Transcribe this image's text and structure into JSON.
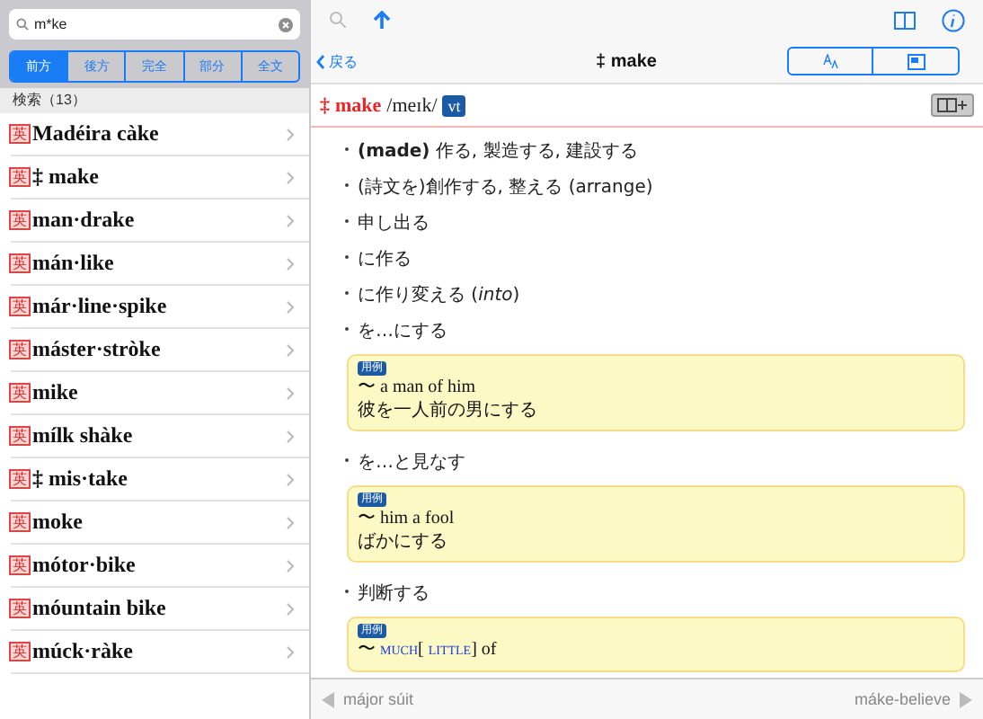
{
  "search": {
    "value": "m*ke"
  },
  "modes": [
    {
      "label": "前方",
      "selected": true
    },
    {
      "label": "後方",
      "selected": false
    },
    {
      "label": "完全",
      "selected": false
    },
    {
      "label": "部分",
      "selected": false
    },
    {
      "label": "全文",
      "selected": false
    }
  ],
  "results": {
    "header": "検索（13）",
    "items": [
      {
        "badge": "英",
        "word": "Madéira càke"
      },
      {
        "badge": "英",
        "word": "‡ make"
      },
      {
        "badge": "英",
        "word": "man·drake"
      },
      {
        "badge": "英",
        "word": "mán·like"
      },
      {
        "badge": "英",
        "word": "már·line·spike"
      },
      {
        "badge": "英",
        "word": "máster·stròke"
      },
      {
        "badge": "英",
        "word": "mike"
      },
      {
        "badge": "英",
        "word": "mílk shàke"
      },
      {
        "badge": "英",
        "word": "‡ mis·take"
      },
      {
        "badge": "英",
        "word": "moke"
      },
      {
        "badge": "英",
        "word": "mótor·bike"
      },
      {
        "badge": "英",
        "word": "móuntain bike"
      },
      {
        "badge": "英",
        "word": "múck·ràke"
      }
    ]
  },
  "nav": {
    "back": "戻る",
    "title": "‡ make"
  },
  "entry": {
    "mark": "‡",
    "headword": "make",
    "pronunciation": "/meɪk/",
    "pos": "vt",
    "senses": [
      {
        "text": "**(made)** 作る, 製造する, 建設する"
      },
      {
        "text": "(詩文を)創作する, 整える (arrange)"
      },
      {
        "text": "申し出る"
      },
      {
        "text": "に作る"
      },
      {
        "text": "に作り変える (*into*)"
      },
      {
        "text": "を…にする",
        "example": {
          "label": "用例",
          "en": [
            {
              "kind": "plain",
              "text": "〜 a man of him"
            }
          ],
          "ja": "彼を一人前の男にする"
        }
      },
      {
        "text": "を…と見なす",
        "example": {
          "label": "用例",
          "en": [
            {
              "kind": "plain",
              "text": "〜 him a fool"
            }
          ],
          "ja": "ばかにする"
        }
      },
      {
        "text": "判断する",
        "example": {
          "label": "用例",
          "en": [
            {
              "kind": "plain",
              "text": "〜 "
            },
            {
              "kind": "term",
              "text": "MUCH"
            },
            {
              "kind": "plain",
              "text": "[ "
            },
            {
              "kind": "term",
              "text": "LITTLE"
            },
            {
              "kind": "plain",
              "text": "] of"
            }
          ]
        }
      }
    ]
  },
  "footer": {
    "previous": "májor súit",
    "next": "máke-believe"
  }
}
